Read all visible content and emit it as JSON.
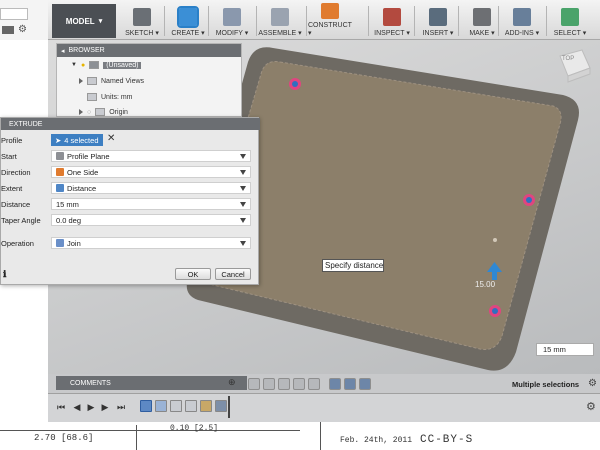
{
  "toolbar": {
    "workspace": "MODEL",
    "items": [
      {
        "label": "SKETCH ▾",
        "icon": "sketch-icon",
        "color": "#6a6f75"
      },
      {
        "label": "CREATE ▾",
        "icon": "create-box-icon",
        "color": "#3b8fd6"
      },
      {
        "label": "MODIFY ▾",
        "icon": "modify-icon",
        "color": "#8a98ad"
      },
      {
        "label": "ASSEMBLE ▾",
        "icon": "assemble-icon",
        "color": "#9aa3b0"
      },
      {
        "label": "CONSTRUCT ▾",
        "icon": "construct-plane-icon",
        "color": "#e07b2f"
      },
      {
        "label": "INSPECT ▾",
        "icon": "inspect-measure-icon",
        "color": "#b34a3f"
      },
      {
        "label": "INSERT ▾",
        "icon": "insert-image-icon",
        "color": "#5a6c7d"
      },
      {
        "label": "MAKE ▾",
        "icon": "make-print-icon",
        "color": "#6d6f73"
      },
      {
        "label": "ADD-INS ▾",
        "icon": "add-ins-icon",
        "color": "#687f9a"
      },
      {
        "label": "SELECT ▾",
        "icon": "select-icon",
        "color": "#4aa36a"
      }
    ]
  },
  "browser": {
    "title": "BROWSER",
    "items": [
      "(Unsaved)",
      "Named Views",
      "Units: mm",
      "Origin"
    ]
  },
  "extrude": {
    "title": "EXTRUDE",
    "profile_label": "Profile",
    "profile_value": "4 selected",
    "start_label": "Start",
    "start_value": "Profile Plane",
    "direction_label": "Direction",
    "direction_value": "One Side",
    "extent_label": "Extent",
    "extent_value": "Distance",
    "distance_label": "Distance",
    "distance_value": "15 mm",
    "taper_label": "Taper Angle",
    "taper_value": "0.0 deg",
    "operation_label": "Operation",
    "operation_value": "Join",
    "ok_label": "OK",
    "cancel_label": "Cancel"
  },
  "viewport": {
    "tooltip": "Specify distance",
    "manipulator_value": "15.00",
    "distance_field": "15 mm",
    "viewcube_label": "TOP",
    "comments_label": "COMMENTS",
    "status": "Multiple selections"
  },
  "background_doc": {
    "dim1": "2.70 [68.6]",
    "dim2": "0.10 [2.5]",
    "date": "Feb. 24th, 2011",
    "license": "CC-BY-S"
  },
  "colors": {
    "tray_fill": "#8c7f6a",
    "tray_rim": "#6e6a63",
    "accent": "#3d7fc2",
    "point_ring": "#e0457f"
  }
}
